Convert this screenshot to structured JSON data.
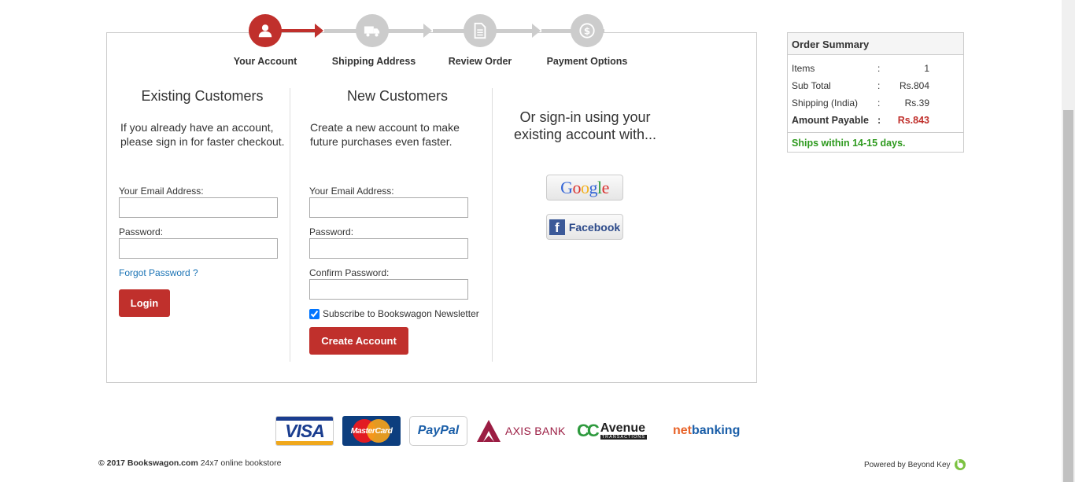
{
  "stepper": {
    "steps": [
      {
        "label": "Your Account",
        "icon": "user-icon",
        "active": true
      },
      {
        "label": "Shipping Address",
        "icon": "truck-icon",
        "active": false
      },
      {
        "label": "Review Order",
        "icon": "document-icon",
        "active": false
      },
      {
        "label": "Payment Options",
        "icon": "dollar-icon",
        "active": false
      }
    ]
  },
  "existing": {
    "title": "Existing Customers",
    "desc_line1": "If you already have an account,",
    "desc_line2": "please sign in for faster checkout.",
    "email_label": "Your Email Address:",
    "email_value": "",
    "password_label": "Password:",
    "password_value": "",
    "forgot_link": "Forgot Password ?",
    "login_button": "Login"
  },
  "new": {
    "title": "New Customers",
    "desc_line1": "Create a new account to make",
    "desc_line2": "future purchases even faster.",
    "email_label": "Your Email Address:",
    "email_value": "",
    "password_label": "Password:",
    "password_value": "",
    "confirm_label": "Confirm Password:",
    "confirm_value": "",
    "newsletter_label": "Subscribe to Bookswagon Newsletter",
    "newsletter_checked": true,
    "create_button": "Create Account"
  },
  "social": {
    "title_line1": "Or sign-in using your",
    "title_line2": "existing account with...",
    "google": "Google",
    "facebook": "Facebook"
  },
  "summary": {
    "title": "Order Summary",
    "rows": [
      {
        "key": "Items",
        "colon": ":",
        "value": "1"
      },
      {
        "key": "Sub Total",
        "colon": ":",
        "value": "Rs.804"
      },
      {
        "key": "Shipping (India)",
        "colon": ":",
        "value": "Rs.39"
      },
      {
        "key": "Amount Payable",
        "colon": ":",
        "value": "Rs.843"
      }
    ],
    "ships": "Ships within 14-15 days."
  },
  "payments": {
    "visa": "VISA",
    "mastercard": "MasterCard",
    "paypal": "PayPal",
    "axis": "AXIS BANK",
    "ccavenue": "Avenue",
    "cc": "CC",
    "ccavenue_sub": "TRANSACTIONS",
    "net": "net",
    "banking": "banking"
  },
  "footer": {
    "copyright": "© 2017 Bookswagon.com",
    "tagline": "24x7 online bookstore",
    "powered": "Powered by Beyond Key"
  },
  "colors": {
    "accent": "#c0302c",
    "link": "#1a73b5",
    "success": "#2e9a1e"
  }
}
